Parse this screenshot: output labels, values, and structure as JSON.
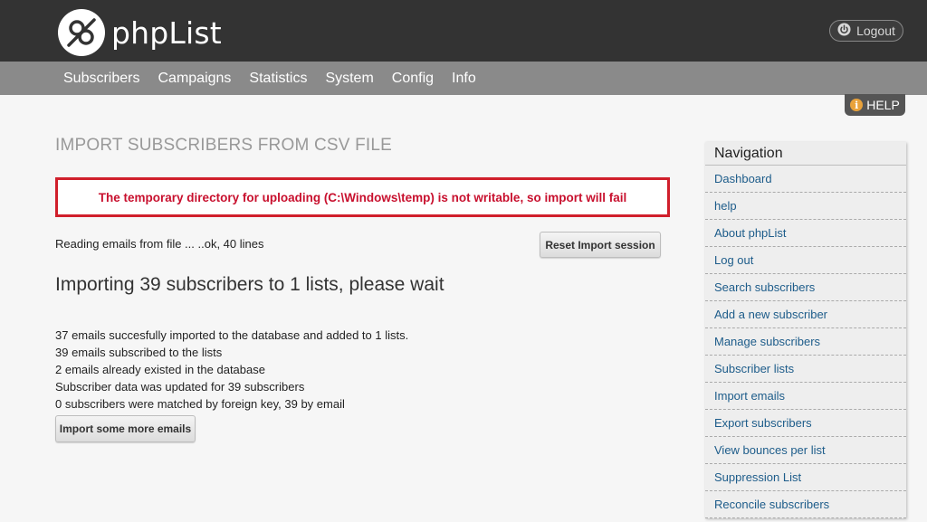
{
  "app": {
    "name": "phpList"
  },
  "header": {
    "logout_label": "Logout"
  },
  "menu": [
    "Subscribers",
    "Campaigns",
    "Statistics",
    "System",
    "Config",
    "Info"
  ],
  "help_label": "HELP",
  "help_icon_glyph": "i",
  "page": {
    "title": "IMPORT SUBSCRIBERS FROM CSV FILE",
    "alert": "The temporary directory for uploading (C:\\Windows\\temp) is not writable, so import will fail",
    "reading": "Reading emails from file ... ..ok, 40 lines",
    "reset_button": "Reset Import session",
    "importing": "Importing 39 subscribers to 1 lists, please wait",
    "results": [
      "37 emails succesfully imported to the database and added to 1 lists.",
      "39 emails subscribed to the lists",
      "2 emails already existed in the database",
      "Subscriber data was updated for 39 subscribers",
      "0 subscribers were matched by foreign key, 39 by email"
    ],
    "more_button": "Import some more emails"
  },
  "sidebar": {
    "title": "Navigation",
    "items": [
      "Dashboard",
      "help",
      "About phpList",
      "Log out",
      "Search subscribers",
      "Add a new subscriber",
      "Manage subscribers",
      "Subscriber lists",
      "Import emails",
      "Export subscribers",
      "View bounces per list",
      "Suppression List",
      "Reconcile subscribers"
    ]
  },
  "colors": {
    "topbar": "#333333",
    "navbar": "#8a8a8a",
    "alert": "#d01f2b",
    "link": "#1d5c8a",
    "help_icon": "#e9a23b"
  }
}
